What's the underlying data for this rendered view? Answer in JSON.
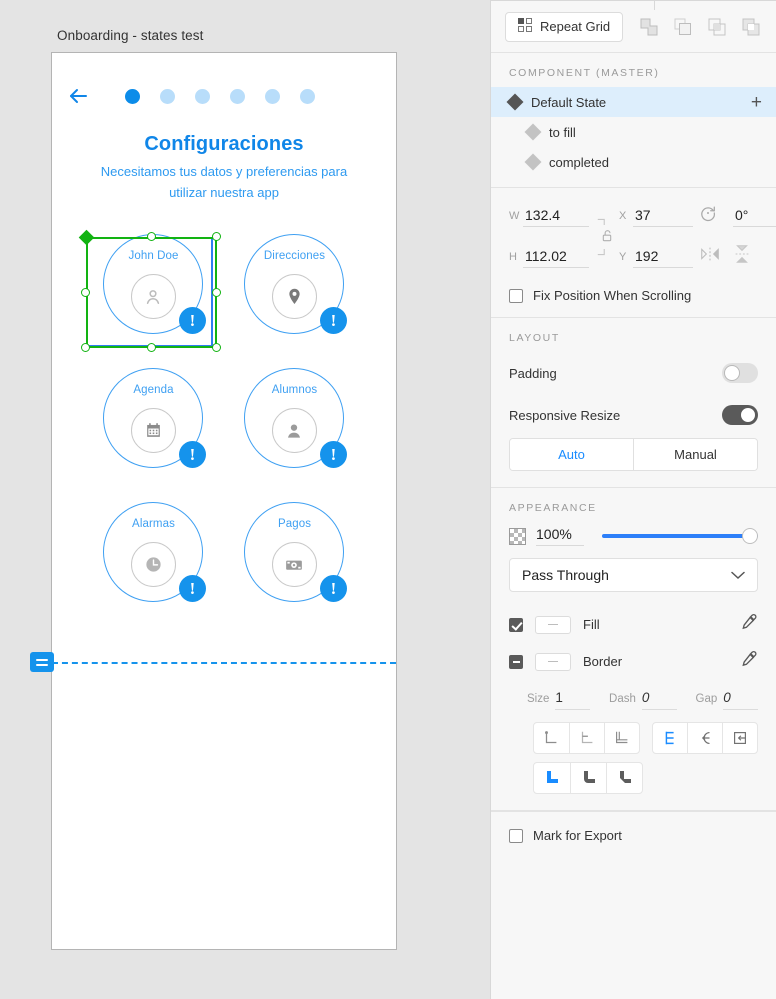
{
  "canvas": {
    "artboard_title": "Onboarding - states test",
    "back_icon": "back-arrow-icon",
    "progress_dots": 6,
    "active_dot_index": 0,
    "active_dot_color": "#0c8ce9",
    "inactive_dot_color": "#b8ddfa",
    "heading": "Configuraciones",
    "subheading": "Necesitamos tus datos y preferencias para utilizar nuestra app",
    "accent_color": "#3fa0f2",
    "badge_color": "#1593ec",
    "badge_text": "!",
    "selection_color": "#12b312",
    "cells": [
      {
        "label": "John Doe",
        "icon": "person-icon"
      },
      {
        "label": "Direcciones",
        "icon": "location-pin-icon"
      },
      {
        "label": "Agenda",
        "icon": "calendar-icon"
      },
      {
        "label": "Alumnos",
        "icon": "person-filled-icon"
      },
      {
        "label": "Alarmas",
        "icon": "clock-icon"
      },
      {
        "label": "Pagos",
        "icon": "money-bill-icon"
      }
    ],
    "scroll_handle_icon": "scroll-group-handle-icon"
  },
  "panel": {
    "toolbar": {
      "repeat_grid_label": "Repeat Grid",
      "repeat_grid_icon": "repeat-grid-icon",
      "boolean_ops": [
        "union-icon",
        "subtract-icon",
        "intersect-icon",
        "exclude-icon"
      ]
    },
    "component": {
      "section_label": "COMPONENT (MASTER)",
      "add_label": "+",
      "states": [
        {
          "name": "Default State",
          "selected": true
        },
        {
          "name": "to fill",
          "selected": false
        },
        {
          "name": "completed",
          "selected": false
        }
      ]
    },
    "dimensions": {
      "w_label": "W",
      "w_value": "132.4",
      "h_label": "H",
      "h_value": "112.02",
      "x_label": "X",
      "x_value": "37",
      "y_label": "Y",
      "y_value": "192",
      "rotation_icon": "rotate-icon",
      "rotation_value": "0°",
      "flip_h_icon": "flip-horizontal-icon",
      "flip_v_icon": "flip-vertical-icon",
      "lock_icon": "unlocked-aspect-ratio-icon",
      "fix_position_label": "Fix Position When Scrolling",
      "fix_position_checked": false
    },
    "layout": {
      "section_label": "LAYOUT",
      "padding_label": "Padding",
      "padding_on": false,
      "responsive_label": "Responsive Resize",
      "responsive_on": true,
      "mode_auto": "Auto",
      "mode_manual": "Manual",
      "mode_active": "Auto"
    },
    "appearance": {
      "section_label": "APPEARANCE",
      "opacity_icon": "transparency-checker-icon",
      "opacity_value": "100%",
      "blend_mode": "Pass Through",
      "blend_chevron_icon": "chevron-down-icon",
      "fill_label": "Fill",
      "fill_checked": true,
      "fill_swatch": "mixed",
      "border_label": "Border",
      "border_checked": "mixed",
      "border_swatch": "mixed",
      "eyedropper_icon": "eyedropper-icon",
      "size_label": "Size",
      "size_value": "1",
      "dash_label": "Dash",
      "dash_value": "0",
      "gap_label": "Gap",
      "gap_value": "0",
      "border_position_icons": [
        "border-inside-icon",
        "border-center-icon",
        "border-outside-icon"
      ],
      "cap_icons": [
        "cap-butt-icon",
        "cap-round-icon",
        "cap-square-icon"
      ],
      "join_icons": [
        "join-miter-icon",
        "join-round-icon",
        "join-bevel-icon"
      ],
      "active_cap_index": 0,
      "active_join_index": 0
    },
    "export": {
      "label": "Mark for Export",
      "checked": false
    }
  }
}
